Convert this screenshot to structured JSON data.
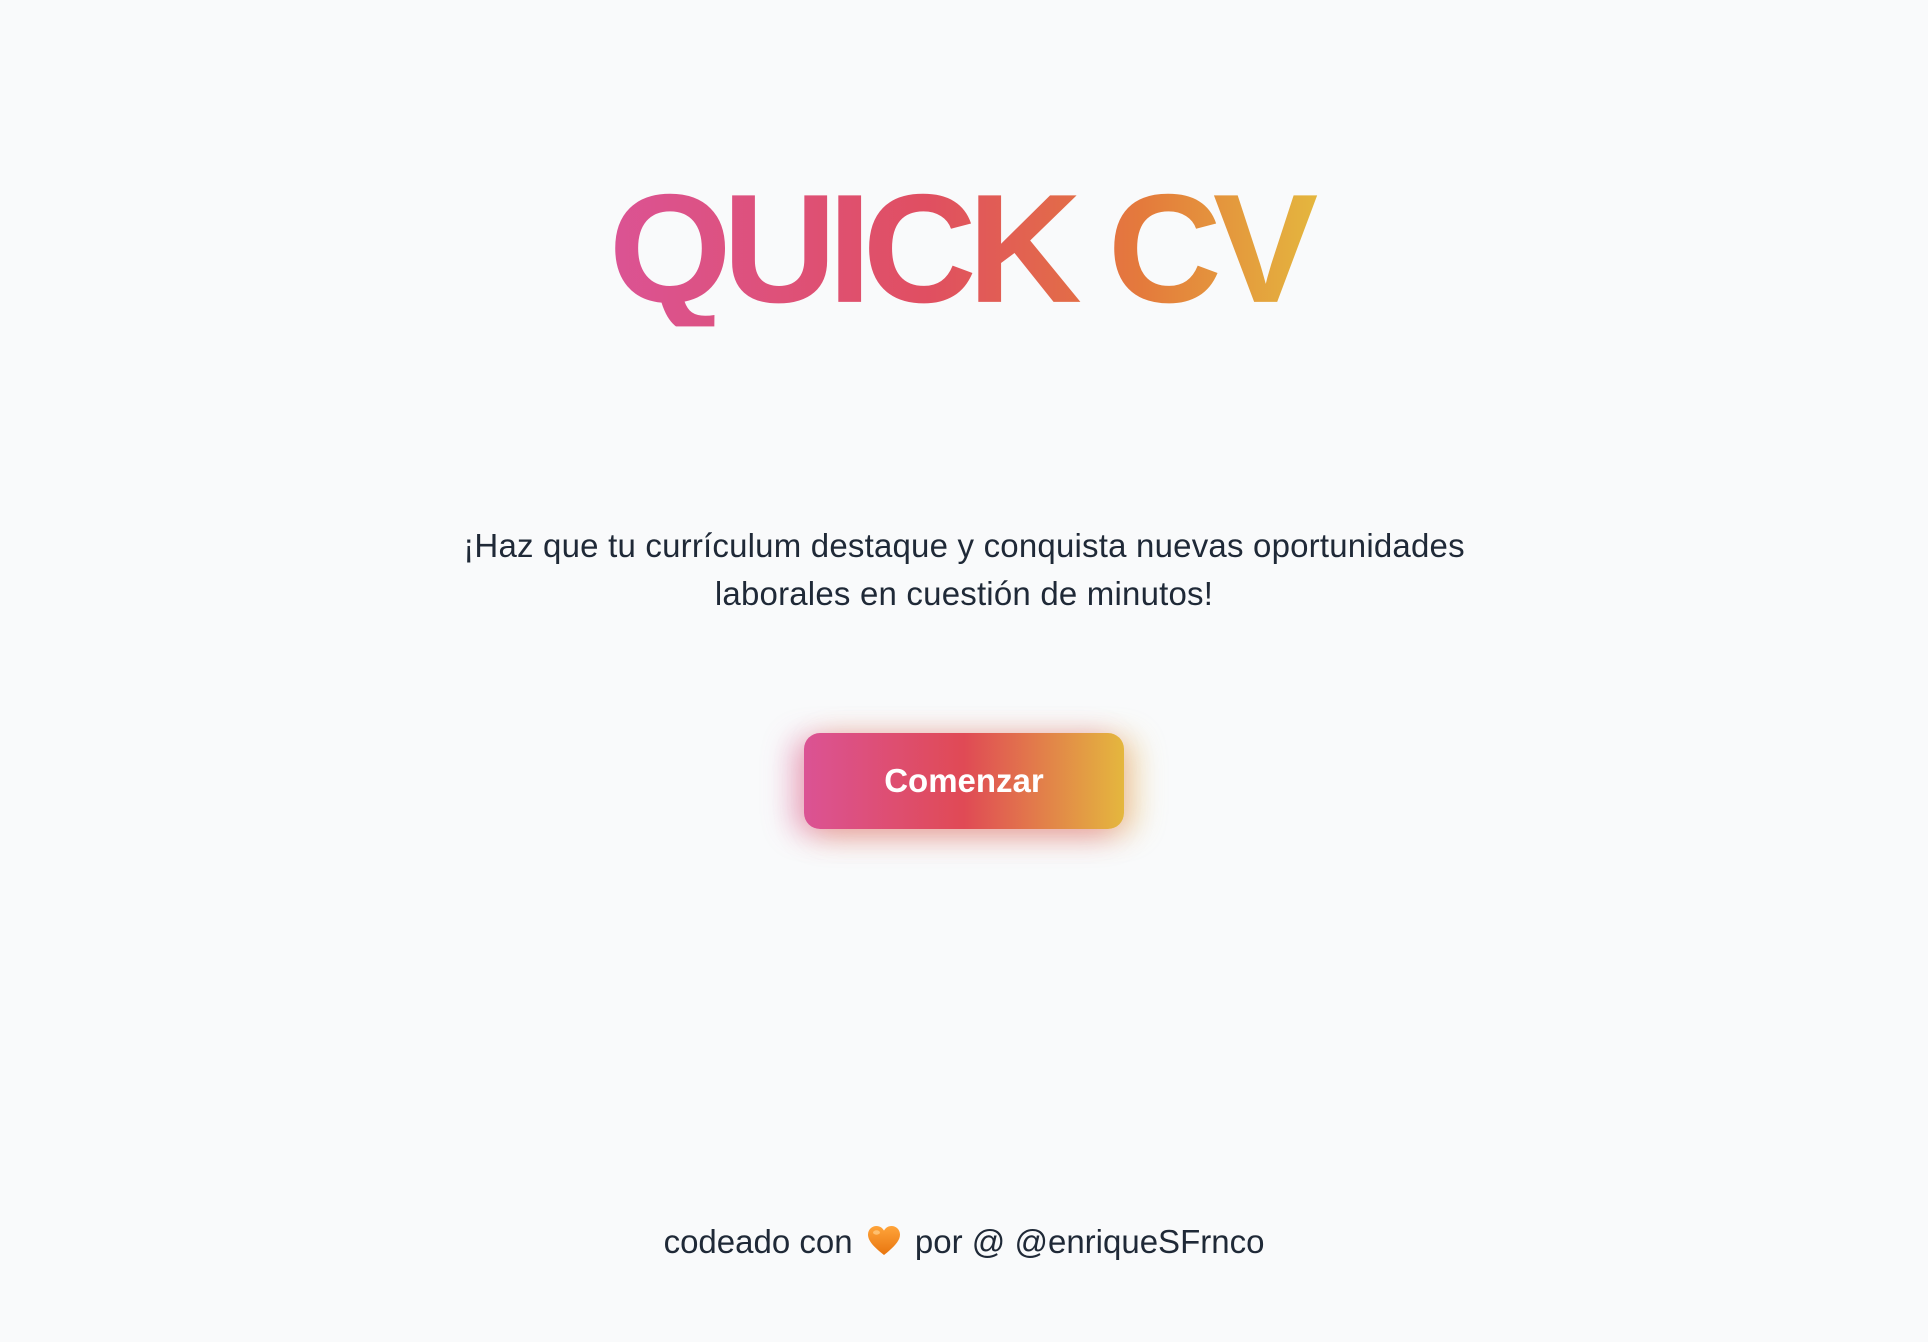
{
  "brand": {
    "title": "QUICK CV",
    "gradient_colors": [
      "#db5394",
      "#e04f61",
      "#e47a3c",
      "#e4b73e"
    ]
  },
  "hero": {
    "tagline": "¡Haz que tu currículum destaque y conquista nuevas oportunidades laborales en cuestión de minutos!",
    "cta_label": "Comenzar"
  },
  "footer": {
    "prefix": "codeado con",
    "heart_icon": "orange-heart-icon",
    "middle": "por",
    "at_symbol": "@",
    "handle": "@enriqueSFrnco"
  },
  "colors": {
    "background": "#f9fafb",
    "text": "#1f2937",
    "heart": "#f28c1e"
  }
}
